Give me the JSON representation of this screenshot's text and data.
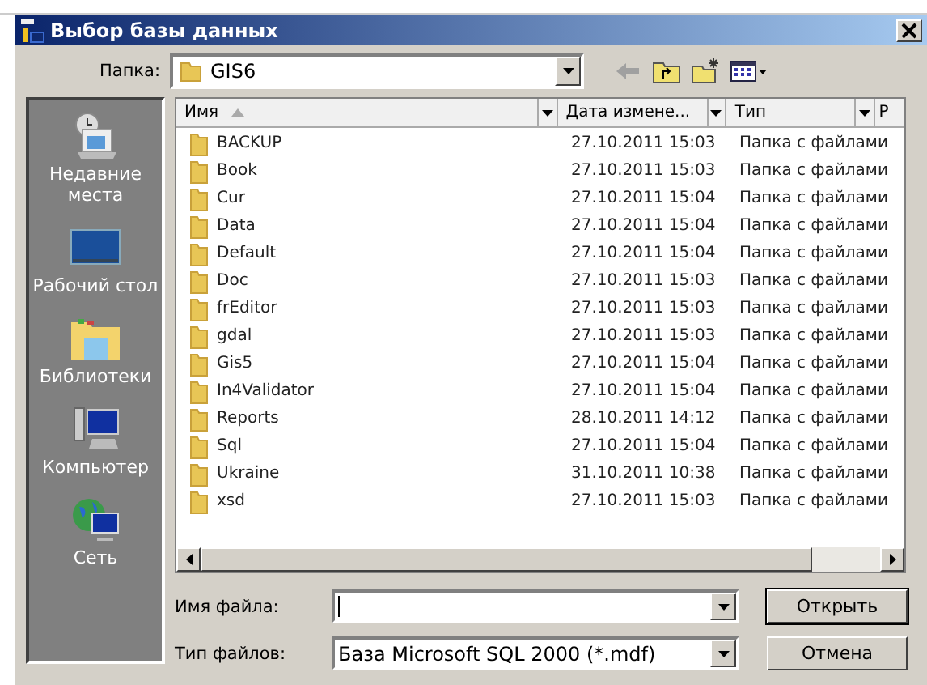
{
  "window": {
    "title": "Выбор базы данных"
  },
  "location": {
    "label": "Папка:",
    "value": "GIS6"
  },
  "places": [
    {
      "kind": "recent",
      "label": "Недавние места"
    },
    {
      "kind": "desktop",
      "label": "Рабочий стол"
    },
    {
      "kind": "libraries",
      "label": "Библиотеки"
    },
    {
      "kind": "computer",
      "label": "Компьютер"
    },
    {
      "kind": "network",
      "label": "Сеть"
    }
  ],
  "table": {
    "columns": [
      "Имя",
      "Дата измене...",
      "Тип",
      "Р"
    ],
    "rows": [
      {
        "name": "BACKUP",
        "date": "27.10.2011 15:03",
        "type": "Папка с файлами"
      },
      {
        "name": "Book",
        "date": "27.10.2011 15:03",
        "type": "Папка с файлами"
      },
      {
        "name": "Cur",
        "date": "27.10.2011 15:04",
        "type": "Папка с файлами"
      },
      {
        "name": "Data",
        "date": "27.10.2011 15:04",
        "type": "Папка с файлами"
      },
      {
        "name": "Default",
        "date": "27.10.2011 15:04",
        "type": "Папка с файлами"
      },
      {
        "name": "Doc",
        "date": "27.10.2011 15:03",
        "type": "Папка с файлами"
      },
      {
        "name": "frEditor",
        "date": "27.10.2011 15:03",
        "type": "Папка с файлами"
      },
      {
        "name": "gdal",
        "date": "27.10.2011 15:03",
        "type": "Папка с файлами"
      },
      {
        "name": "Gis5",
        "date": "27.10.2011 15:04",
        "type": "Папка с файлами"
      },
      {
        "name": "In4Validator",
        "date": "27.10.2011 15:04",
        "type": "Папка с файлами"
      },
      {
        "name": "Reports",
        "date": "28.10.2011 14:12",
        "type": "Папка с файлами"
      },
      {
        "name": "Sql",
        "date": "27.10.2011 15:04",
        "type": "Папка с файлами"
      },
      {
        "name": "Ukraine",
        "date": "31.10.2011 10:38",
        "type": "Папка с файлами"
      },
      {
        "name": "xsd",
        "date": "27.10.2011 15:03",
        "type": "Папка с файлами"
      }
    ]
  },
  "file_name": {
    "label": "Имя файла:"
  },
  "file_type": {
    "label": "Тип файлов:",
    "value": "База Microsoft SQL 2000 (*.mdf)"
  },
  "buttons": [
    "Открыть",
    "Отмена"
  ]
}
